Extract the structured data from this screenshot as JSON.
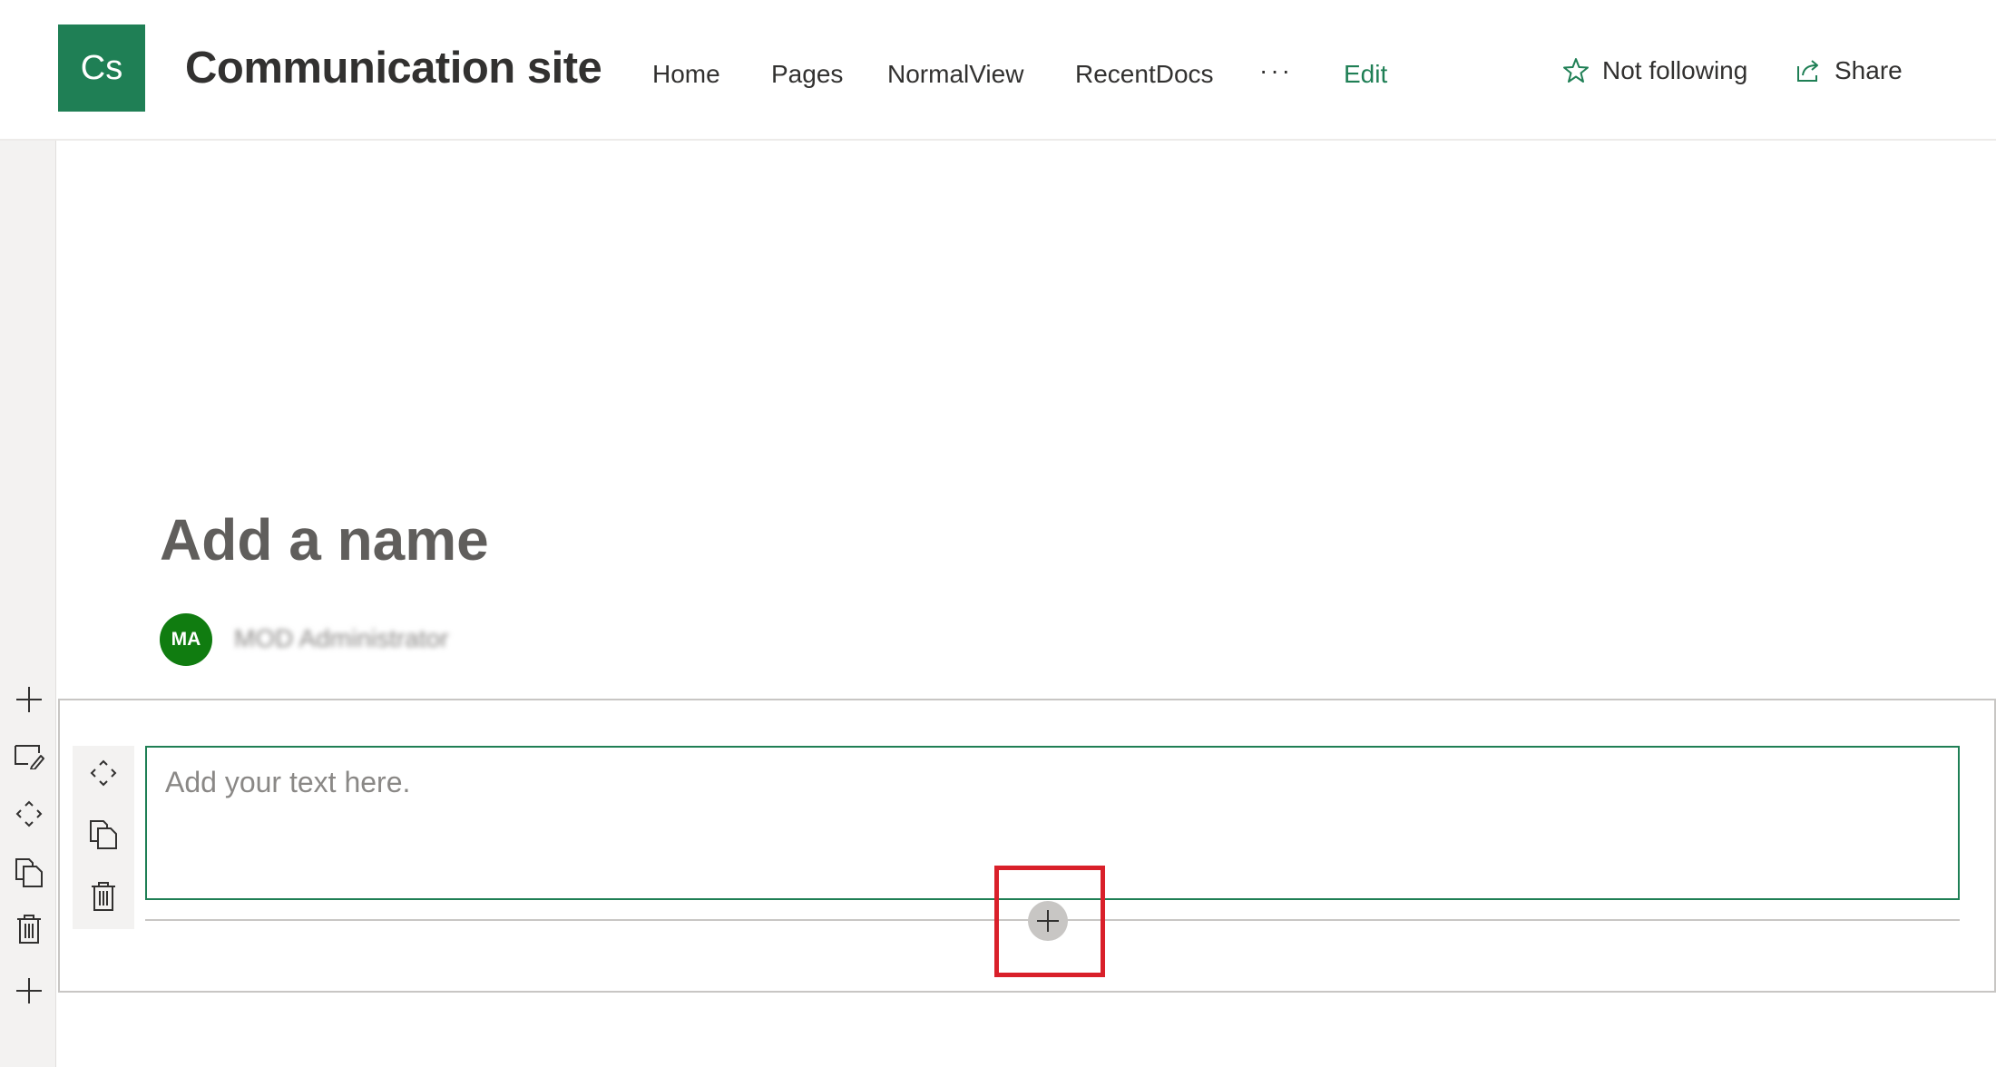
{
  "header": {
    "logo_text": "Cs",
    "site_title": "Communication site",
    "nav": [
      "Home",
      "Pages",
      "NormalView",
      "RecentDocs"
    ],
    "more_label": "···",
    "edit_label": "Edit",
    "follow_label": "Not following",
    "share_label": "Share"
  },
  "page": {
    "title": "Add a name",
    "author_initials": "MA",
    "author_name": "MOD Administrator"
  },
  "text_webpart": {
    "placeholder": "Add your text here."
  },
  "icons": {
    "follow": "star-icon",
    "share": "share-icon",
    "rail": [
      "add-section-icon",
      "edit-section-icon",
      "move-section-icon",
      "duplicate-section-icon",
      "delete-section-icon",
      "add-section-icon"
    ],
    "webpart": [
      "move-icon",
      "duplicate-icon",
      "delete-icon"
    ],
    "add_webpart": "plus-icon"
  },
  "colors": {
    "brand": "#1f7f55",
    "avatar": "#107c10",
    "highlight": "#d9202a"
  }
}
